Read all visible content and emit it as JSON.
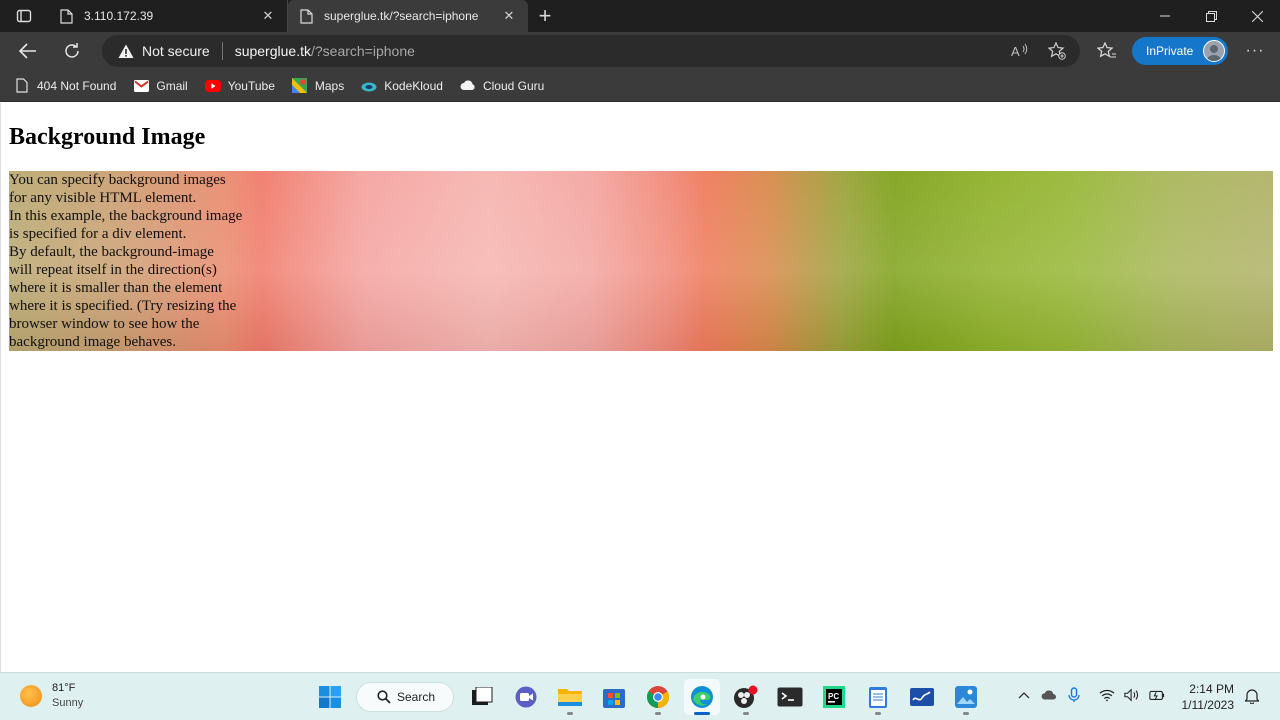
{
  "tabs": [
    {
      "title": "3.110.172.39",
      "active": false
    },
    {
      "title": "superglue.tk/?search=iphone",
      "active": true
    }
  ],
  "toolbar": {
    "security_label": "Not secure",
    "url_host": "superglue.tk",
    "url_rest": "/?search=iphone",
    "inprivate_label": "InPrivate"
  },
  "bookmarks": [
    {
      "label": "404 Not Found",
      "icon": "page-icon"
    },
    {
      "label": "Gmail",
      "icon": "gmail-icon"
    },
    {
      "label": "YouTube",
      "icon": "youtube-icon"
    },
    {
      "label": "Maps",
      "icon": "maps-icon"
    },
    {
      "label": "KodeKloud",
      "icon": "kodekloud-icon"
    },
    {
      "label": "Cloud Guru",
      "icon": "cloud-icon"
    }
  ],
  "page": {
    "heading": "Background Image",
    "lines": [
      "You can specify background images",
      "for any visible HTML element.",
      "In this example, the background image",
      "is specified for a div element.",
      "By default, the background-image",
      "will repeat itself in the direction(s)",
      "where it is smaller than the element",
      "where it is specified. (Try resizing the",
      "browser window to see how the",
      "background image behaves."
    ]
  },
  "taskbar": {
    "weather_temp": "81°F",
    "weather_cond": "Sunny",
    "search_label": "Search",
    "time": "2:14 PM",
    "date": "1/11/2023"
  },
  "colors": {
    "inprivate": "#1577c9",
    "taskbar": "#dff0f1",
    "tabstrip": "#1f1f1f",
    "toolbar": "#3b3b3b"
  }
}
